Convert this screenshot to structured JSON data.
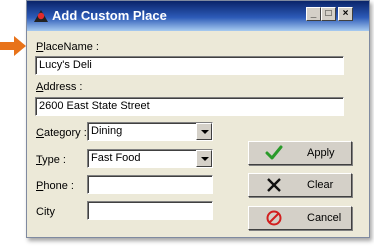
{
  "window": {
    "title": "Add Custom Place",
    "controls": {
      "minimize": "_",
      "maximize": "□",
      "close": "×"
    }
  },
  "form": {
    "place_name": {
      "label_prefix": "",
      "label_accel": "P",
      "label_rest": "laceName :",
      "value": "Lucy's Deli"
    },
    "address": {
      "label_accel": "A",
      "label_rest": "ddress :",
      "value": "2600 East State Street"
    },
    "category": {
      "label_accel": "C",
      "label_rest": "ategory :",
      "value": "Dining"
    },
    "type": {
      "label_accel": "T",
      "label_rest": "ype :",
      "value": "Fast Food"
    },
    "phone": {
      "label_accel": "P",
      "label_rest": "hone :",
      "value": ""
    },
    "city": {
      "label": "City",
      "value": ""
    }
  },
  "buttons": {
    "apply": "Apply",
    "clear": "Clear",
    "cancel": "Cancel"
  },
  "icons": {
    "pointer": "red-arrow-pointer-icon",
    "title": "map-pin-icon",
    "apply": "green-checkmark-icon",
    "clear": "black-x-icon",
    "cancel": "red-prohibited-icon"
  },
  "colors": {
    "arrow": "#e8731a",
    "titlebar": "#0a246a",
    "apply_check": "#2a9a2a",
    "cancel_circle": "#d21f1f"
  }
}
